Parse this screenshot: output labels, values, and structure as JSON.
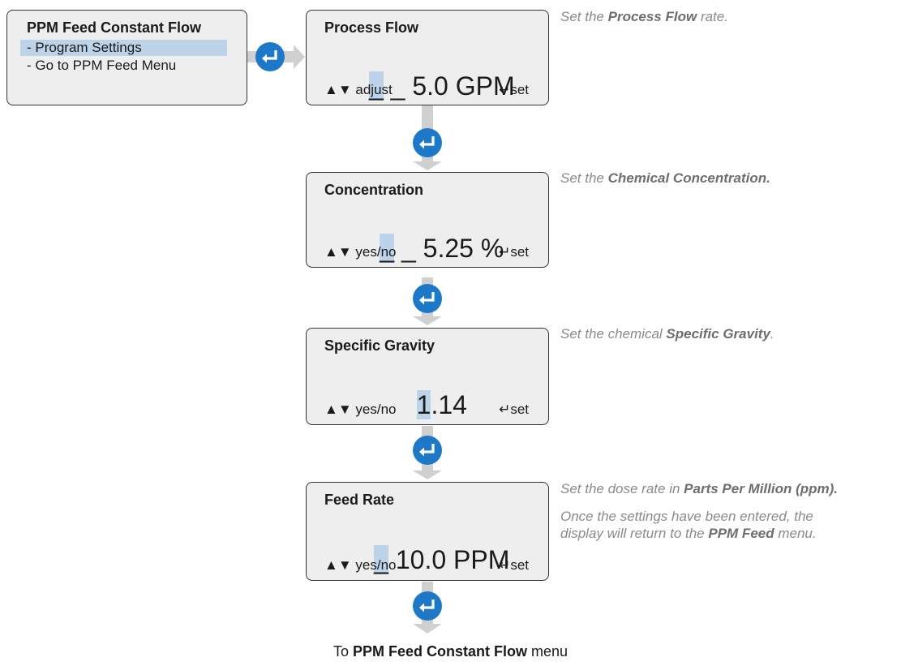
{
  "menu": {
    "title": "PPM Feed Constant Flow",
    "items": [
      "- Program Settings",
      "- Go to PPM Feed Menu"
    ],
    "selected_index": 0
  },
  "steps": [
    {
      "title": "Process Flow",
      "cursor": "_",
      "value_rest": " _ 5.0 GPM",
      "foot_left": "adjust",
      "foot_right": "set",
      "note": {
        "pre": "Set the ",
        "bold": "Process Flow",
        "post": " rate."
      }
    },
    {
      "title": "Concentration",
      "cursor": "_",
      "value_rest": " _ 5.25 %",
      "foot_left": "yes/no",
      "foot_right": "set",
      "note": {
        "pre": "Set the ",
        "bold": "Chemical Concentration.",
        "post": ""
      }
    },
    {
      "title": "Specific Gravity",
      "cursor": "1",
      "value_rest": ".14",
      "foot_left": "yes/no",
      "foot_right": "set",
      "note": {
        "pre": "Set the chemical ",
        "bold": "Specific Gravity",
        "post": "."
      }
    },
    {
      "title": "Feed Rate",
      "cursor": "_",
      "value_rest": " 10.0 PPM",
      "foot_left": "yes/no",
      "foot_right": "set",
      "note": {
        "pre": "Set the dose rate in ",
        "bold": "Parts Per Million (ppm).",
        "post": ""
      }
    }
  ],
  "final_note": {
    "line1": "Once the settings have been entered, the",
    "line2_pre": "display will return to the ",
    "line2_bold": "PPM Feed",
    "line2_post": " menu."
  },
  "caption": {
    "pre": "To ",
    "bold": "PPM Feed Constant Flow",
    "post": " menu"
  },
  "colors": {
    "accent": "#1e78c8",
    "highlight": "#bcd3ea",
    "arrow": "#d0d0d0",
    "note_text": "#8a8a8a"
  }
}
